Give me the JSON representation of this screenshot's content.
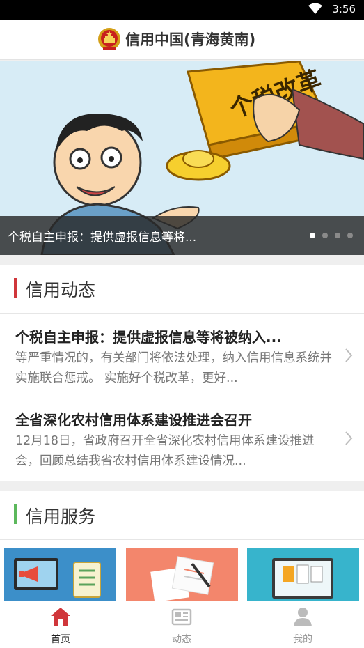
{
  "status_bar": {
    "time": "3:56"
  },
  "header": {
    "title": "信用中国(青海黄南)"
  },
  "banner": {
    "caption": "个税自主申报：提供虚报信息等将...",
    "illustration_text": "个税改革",
    "slide_count": 4,
    "active_slide": 1
  },
  "news_section": {
    "title": "信用动态",
    "accent_color": "#d0363b",
    "items": [
      {
        "headline": "个税自主申报：提供虚报信息等将被纳入...",
        "summary": "等严重情况的，有关部门将依法处理，纳入信用信息系统并实施联合惩戒。 实施好个税改革，更好..."
      },
      {
        "headline": "全省深化农村信用体系建设推进会召开",
        "summary": "12月18日，省政府召开全省深化农村信用体系建设推进会，回顾总结我省农村信用体系建设情况..."
      }
    ]
  },
  "service_section": {
    "title": "信用服务",
    "accent_color": "#5cb85c",
    "cards": [
      {
        "icon": "announcement-checklist-icon",
        "bg": "#3c8fc9"
      },
      {
        "icon": "documents-pen-icon",
        "bg": "#f3866c"
      },
      {
        "icon": "monitor-documents-icon",
        "bg": "#37b4cc"
      }
    ]
  },
  "tab_bar": {
    "tabs": [
      {
        "label": "首页",
        "icon": "home-icon",
        "active": true,
        "color": "#d0363b"
      },
      {
        "label": "动态",
        "icon": "news-icon",
        "active": false,
        "color": "#bbbbbb"
      },
      {
        "label": "我的",
        "icon": "user-icon",
        "active": false,
        "color": "#bbbbbb"
      }
    ]
  }
}
